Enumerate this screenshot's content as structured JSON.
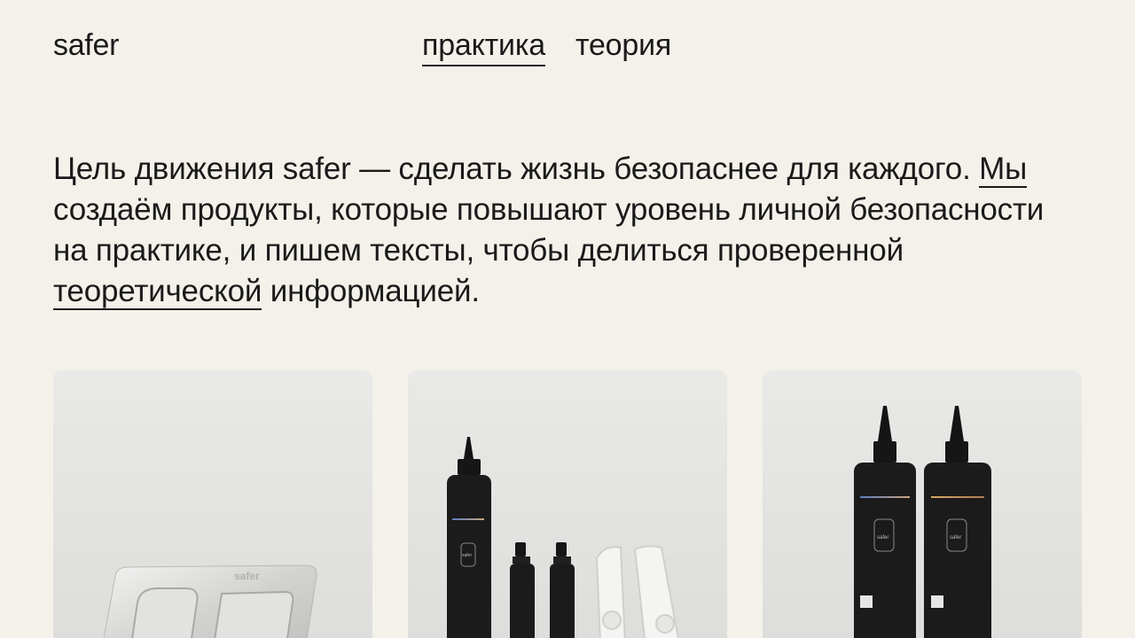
{
  "header": {
    "logo": "safer",
    "nav": [
      {
        "label": "практика",
        "active": true
      },
      {
        "label": "теория",
        "active": false
      }
    ]
  },
  "intro": {
    "part1": "Цель движения safer — сделать жизнь безопаснее для каждого. ",
    "link_we": "Мы",
    "part2": " создаём продукты, которые повышают уровень личной безопасности на практике, и пишем тексты, чтобы делиться проверенной ",
    "link_theory": "теоретической",
    "part3": " информацией."
  },
  "products": [
    {
      "image": "metal-tool-product-photo",
      "engraving": "safer"
    },
    {
      "image": "kit-bottles-sprays-tools-photo",
      "bottle_brand": "safer"
    },
    {
      "image": "two-bottles-photo",
      "bottle_brand": "safer"
    }
  ]
}
